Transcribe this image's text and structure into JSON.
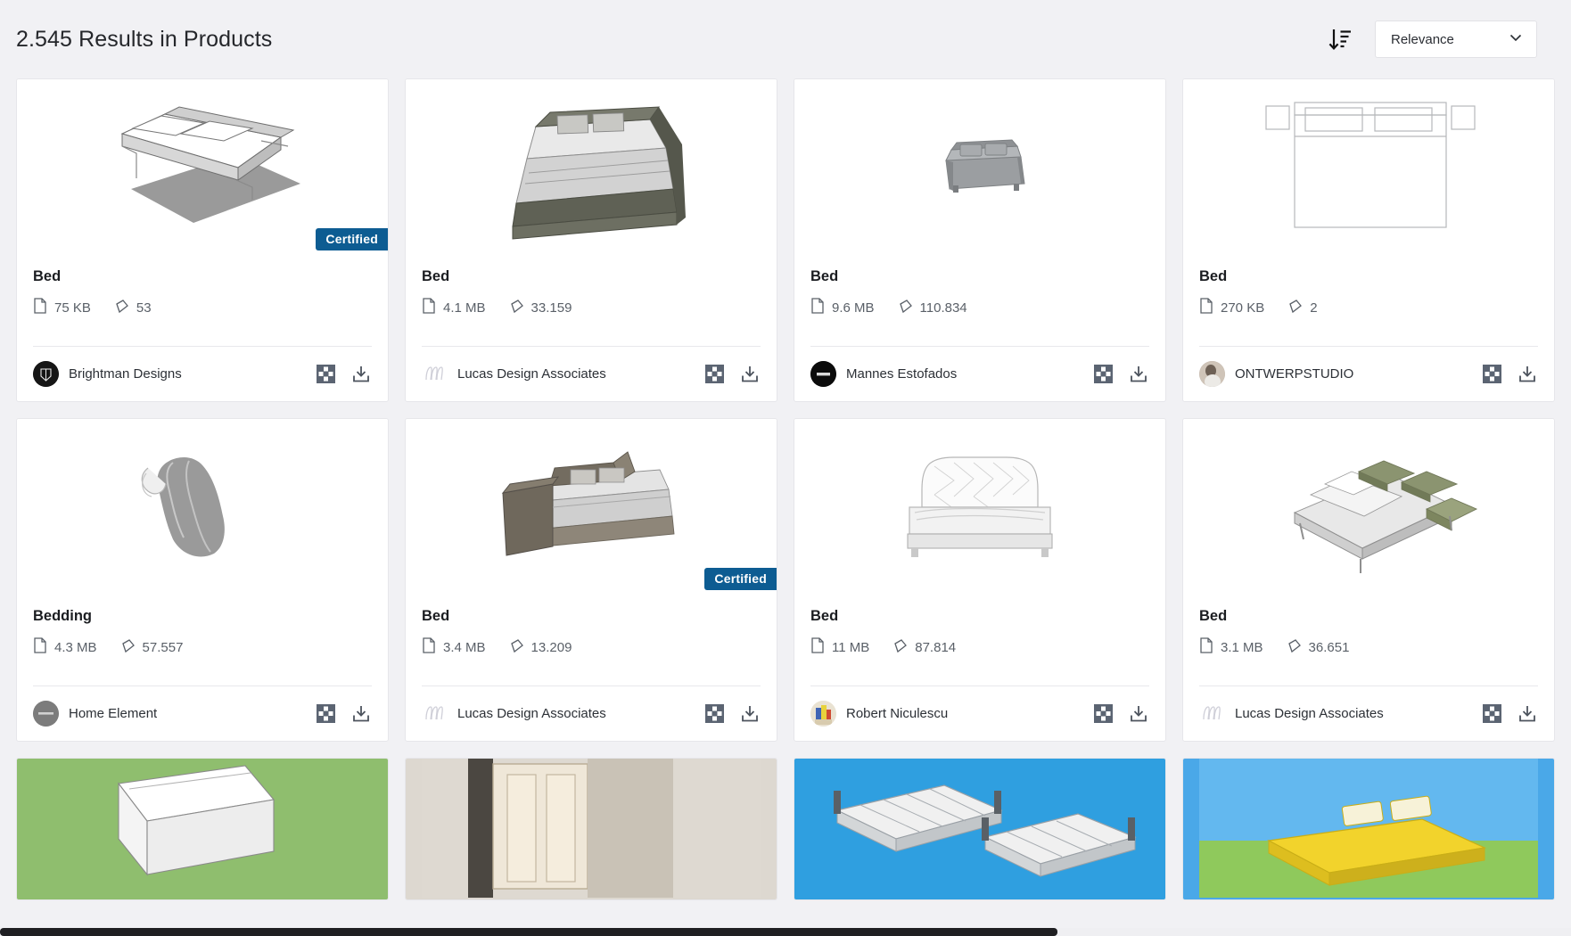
{
  "header": {
    "results_title": "2.545 Results in Products",
    "sort_direction_icon": "sort-descending-icon",
    "sort_value": "Relevance",
    "sort_chevron_icon": "chevron-down-icon"
  },
  "icons": {
    "file_size": "file-icon",
    "polygons": "polygon-icon",
    "ar_view": "ar-marker-icon",
    "download": "download-icon"
  },
  "cards": [
    {
      "title": "Bed",
      "file_size": "75 KB",
      "polygons": "53",
      "author": "Brightman Designs",
      "avatar_type": "dark-monogram",
      "avatar_color": "#161616",
      "badge": "Certified",
      "thumb": "bed-frame-wire"
    },
    {
      "title": "Bed",
      "file_size": "4.1 MB",
      "polygons": "33.159",
      "author": "Lucas Design Associates",
      "avatar_type": "script-logo",
      "avatar_color": "#d9d9e0",
      "badge": null,
      "thumb": "bed-grey-footboard"
    },
    {
      "title": "Bed",
      "file_size": "9.6 MB",
      "polygons": "110.834",
      "author": "Mannes Estofados",
      "avatar_type": "black-circle",
      "avatar_color": "#0b0b0b",
      "badge": null,
      "thumb": "sofa-small-grey"
    },
    {
      "title": "Bed",
      "file_size": "270 KB",
      "polygons": "2",
      "author": "ONTWERPSTUDIO",
      "avatar_type": "photo",
      "avatar_color": "#b9ada2",
      "badge": null,
      "thumb": "bed-plan-outline"
    },
    {
      "title": "Bedding",
      "file_size": "4.3 MB",
      "polygons": "57.557",
      "author": "Home Element",
      "avatar_type": "grey-circle",
      "avatar_color": "#7c7c7c",
      "badge": null,
      "thumb": "duvet-grey"
    },
    {
      "title": "Bed",
      "file_size": "3.4 MB",
      "polygons": "13.209",
      "author": "Lucas Design Associates",
      "avatar_type": "script-logo",
      "avatar_color": "#d9d9e0",
      "badge": "Certified",
      "thumb": "bed-brown-upholstered"
    },
    {
      "title": "Bed",
      "file_size": "11 MB",
      "polygons": "87.814",
      "author": "Robert Niculescu",
      "avatar_type": "colorful-photo",
      "avatar_color": "#e2c98f",
      "badge": null,
      "thumb": "bed-tufted-white"
    },
    {
      "title": "Bed",
      "file_size": "3.1 MB",
      "polygons": "36.651",
      "author": "Lucas Design Associates",
      "avatar_type": "script-logo",
      "avatar_color": "#d9d9e0",
      "badge": null,
      "thumb": "bed-with-nightstands"
    }
  ],
  "partial_row": [
    {
      "thumb": "green-scene",
      "bg": "#8fbe6e"
    },
    {
      "thumb": "beige-room",
      "bg": "#ddd8d0"
    },
    {
      "thumb": "blue-pool-deck",
      "bg": "#2f9fe0"
    },
    {
      "thumb": "yellow-sun-lounger",
      "bg": "#4aa8e8"
    }
  ]
}
